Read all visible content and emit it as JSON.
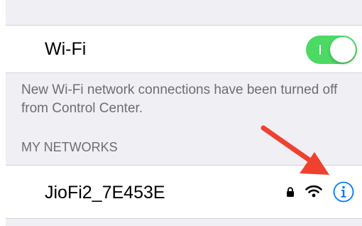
{
  "wifi": {
    "label": "Wi-Fi",
    "enabled": true
  },
  "footer_note": "New Wi-Fi network connections have been turned off from Control Center.",
  "networks_section": {
    "header": "MY NETWORKS",
    "items": [
      {
        "ssid": "JioFi2_7E453E",
        "secured": true,
        "icons": [
          "lock-icon",
          "wifi-signal-icon",
          "info-icon"
        ]
      }
    ]
  },
  "colors": {
    "toggle_on": "#4cd964",
    "accent": "#007aff",
    "annotation_arrow": "#f0412e",
    "grouped_background": "#efeff4",
    "secondary_text": "#6d6d72"
  }
}
